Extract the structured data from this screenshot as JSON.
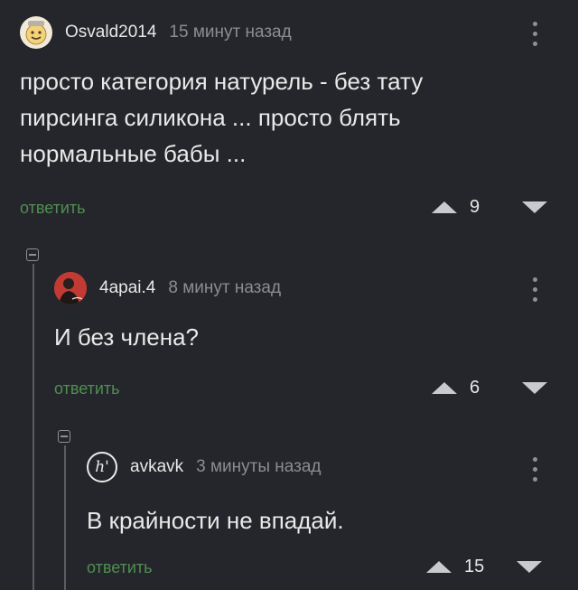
{
  "comments": [
    {
      "username": "Osvald2014",
      "time": "15 минут назад",
      "text": "просто категория натурель - без тату\nпирсинга силикона ... просто блять\nнормальные бабы ...",
      "reply_label": "ответить",
      "score": "9",
      "avatar_icon": "smiley-face-icon"
    },
    {
      "username": "4apai.4",
      "time": "8 минут назад",
      "text": "И без члена?",
      "reply_label": "ответить",
      "score": "6",
      "avatar_icon": "portrait-avatar-icon"
    },
    {
      "username": "avkavk",
      "time": "3 минуты назад",
      "text": "В крайности не впадай.",
      "reply_label": "ответить",
      "score": "15",
      "avatar_icon": "h-logo-avatar-icon",
      "avatar_glyph": "h'"
    }
  ],
  "colors": {
    "background": "#25262b",
    "reply_link": "#4f8f52",
    "muted": "#8b8d92"
  }
}
